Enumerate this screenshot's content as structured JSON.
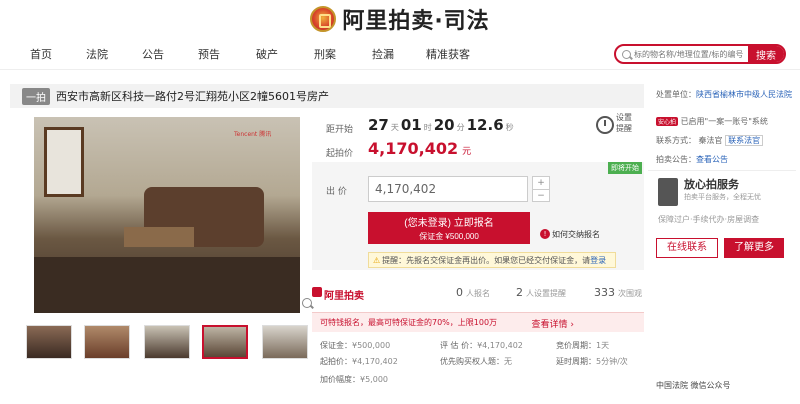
{
  "header": {
    "brand": "阿里拍卖·司法"
  },
  "nav": {
    "items": [
      "首页",
      "法院",
      "公告",
      "预告",
      "破产",
      "刑案",
      "捡漏",
      "精准获客"
    ],
    "search_placeholder": "标的物名称/地理位置/标的编号",
    "search_button": "搜索"
  },
  "listing": {
    "tag": "一拍",
    "title": "西安市高新区科技一路付2号汇翔苑小区2幢5601号房产",
    "img_watermark": "Tencent 腾讯"
  },
  "countdown": {
    "label": "距开始",
    "days": "27",
    "days_unit": "天",
    "hours": "01",
    "hours_unit": "时",
    "minutes": "20",
    "minutes_unit": "分",
    "seconds": "12.6",
    "seconds_unit": "秒"
  },
  "start_price": {
    "label": "起拍价",
    "value": "4,170,402",
    "unit": "元"
  },
  "remind": {
    "label": "设置提醒"
  },
  "bid": {
    "soon_badge": "即将开始",
    "label": "出 价",
    "value": "4,170,402",
    "plus": "+",
    "minus": "−",
    "signup_line1": "(您未登录) 立即报名",
    "signup_line2": "保证金 ¥500,000",
    "help": "如何交纳报名",
    "notice_prefix": "提醒：先报名交保证金再出价。如果您已经交付保证金，请",
    "notice_link": "登录"
  },
  "stats": {
    "brand": "阿里拍卖",
    "signups": "0",
    "signups_label": "人报名",
    "reminders": "2",
    "reminders_label": "人设置提醒",
    "views": "333",
    "views_label": "次围观"
  },
  "tip": {
    "text": "可特钱报名，最高可特保证金的70%，上限100万",
    "link": "查看详情 ›"
  },
  "info": {
    "deposit_label": "保证金：",
    "deposit": "¥500,000",
    "start_label": "起拍价：",
    "start": "¥4,170,402",
    "increment_label": "加价幅度：",
    "increment": "¥5,000",
    "valuation_label": "评 估 价：",
    "valuation": "¥4,170,402",
    "priority_label": "优先购买权人题：",
    "priority": "无",
    "cycle_label": "竞价周期：",
    "cycle": "1天",
    "extend_label": "延时周期：",
    "extend": "5分钟/次"
  },
  "sidebar": {
    "org_label": "处置单位：",
    "org": "陕西省榆林市中级人民法院",
    "badge": "安心拍",
    "badge_text": "已启用\"一案一账号\"系统",
    "contact_label": "联系方式：",
    "contact_name": "秦法官",
    "contact_link": "联系法官",
    "notice_label": "拍卖公告：",
    "notice_link": "查看公告",
    "service_title": "放心拍服务",
    "service_sub": "拍卖平台服务，全程无忧",
    "service_tags": "保障过户·手续代办·房屋调查",
    "online_button": "在线联系",
    "more_button": "了解更多",
    "bottom_watermark": "中国法院 微信公众号"
  },
  "colors": {
    "accent": "#c8102e",
    "link": "#2a63b8"
  }
}
